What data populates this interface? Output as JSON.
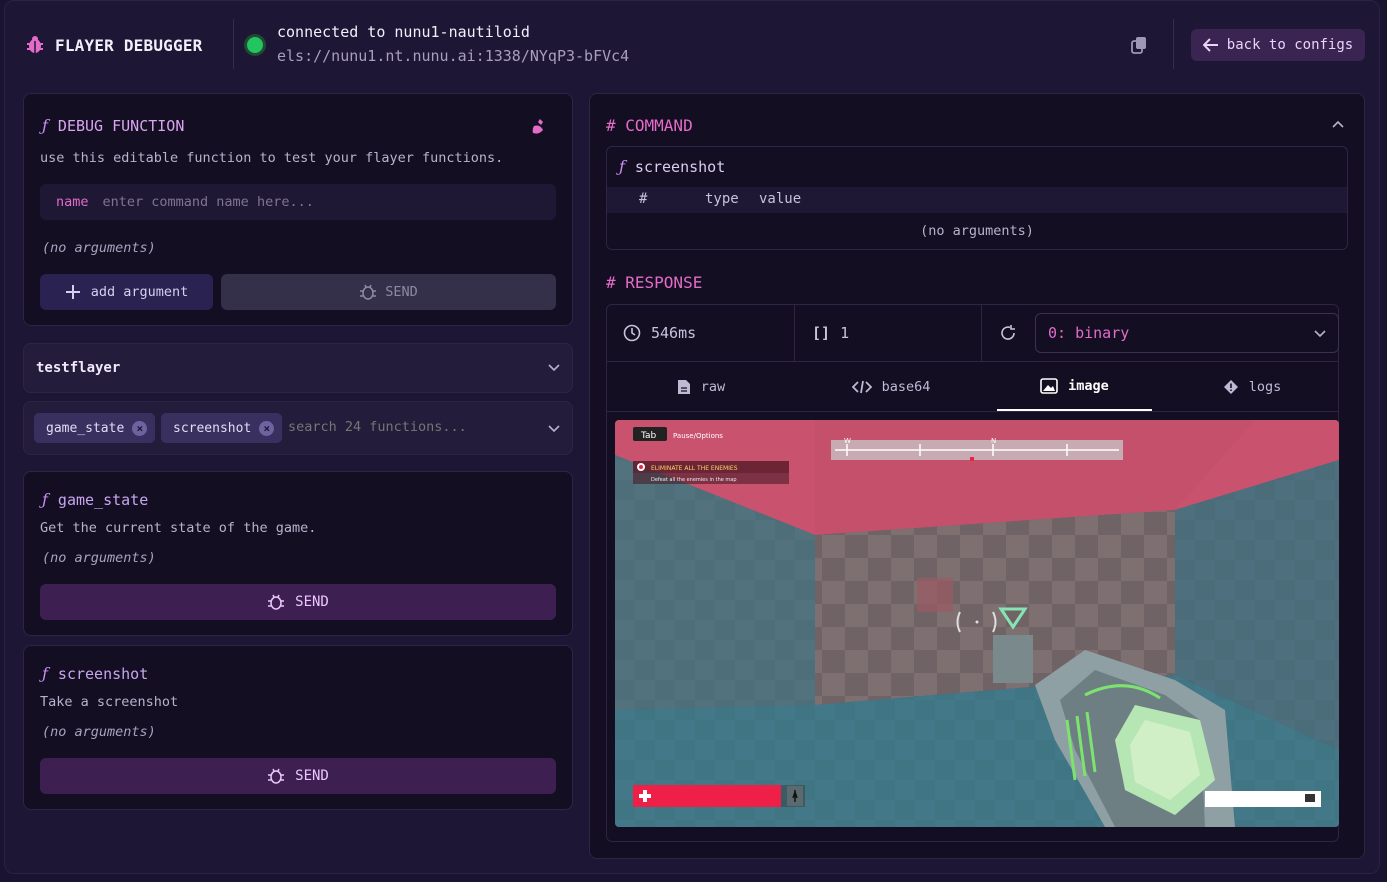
{
  "header": {
    "title": "FLAYER DEBUGGER",
    "connection_title": "connected to nunu1-nautiloid",
    "connection_url": "els://nunu1.nt.nunu.ai:1338/NYqP3-bFVc4",
    "back_label": "back to configs",
    "status_color": "#22c55e"
  },
  "debug_function": {
    "title": "DEBUG FUNCTION",
    "description": "use this editable function to test your flayer functions.",
    "name_label": "name",
    "name_placeholder": "enter command name here...",
    "args_text": "(no arguments)",
    "add_argument_label": "add argument",
    "send_label": "SEND"
  },
  "flayer_select": {
    "value": "testflayer"
  },
  "function_filter": {
    "chips": [
      "game_state",
      "screenshot"
    ],
    "search_placeholder": "search 24 functions..."
  },
  "functions": [
    {
      "name": "game_state",
      "description": "Get the current state of the game.",
      "args_text": "(no arguments)",
      "send_label": "SEND"
    },
    {
      "name": "screenshot",
      "description": "Take a screenshot",
      "args_text": "(no arguments)",
      "send_label": "SEND"
    }
  ],
  "command": {
    "heading": "# COMMAND",
    "name": "screenshot",
    "columns": [
      "#",
      "type",
      "value"
    ],
    "empty_text": "(no arguments)"
  },
  "response": {
    "heading": "# RESPONSE",
    "time": "546ms",
    "count": "1",
    "selected_item": "0: binary",
    "tabs": [
      "raw",
      "base64",
      "image",
      "logs"
    ],
    "active_tab": "image"
  },
  "game_hud": {
    "tab_key": "Tab",
    "tab_hint": "Pause/Options",
    "compass_w": "W",
    "compass_n": "N",
    "objective_title": "ELIMINATE ALL THE ENEMIES",
    "objective_sub": "Defeat all the enemies in the map",
    "health_fraction": 0.95
  },
  "colors": {
    "accent_pink": "#e26cc8",
    "accent_purple": "#c98ef0",
    "health_red": "#ef2048",
    "ceiling": "#c9536f"
  }
}
